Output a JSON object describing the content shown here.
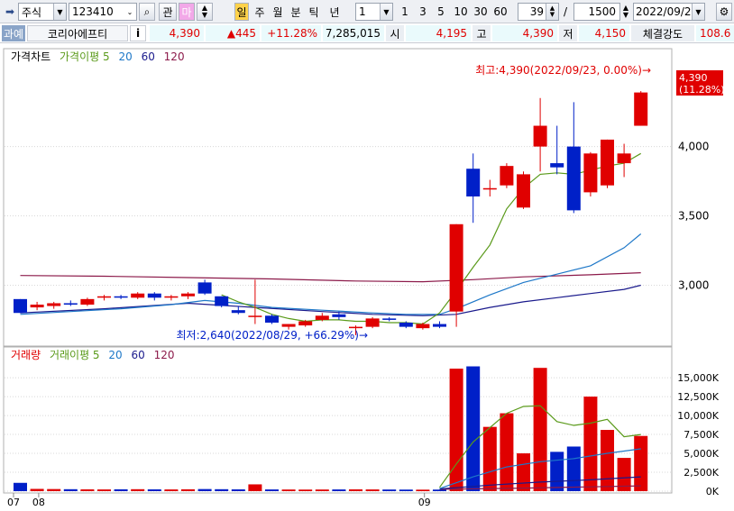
{
  "toolbar": {
    "type_select": "주식",
    "code_value": "123410",
    "btn_gwan": "관",
    "btn_ma": "마",
    "periods": [
      "일",
      "주",
      "월",
      "분",
      "틱",
      "년"
    ],
    "interval_value": "1",
    "quick_intervals": [
      "1",
      "3",
      "5",
      "10",
      "30",
      "60"
    ],
    "count_value": "39",
    "count_sep": "/",
    "count_total": "1500",
    "date_value": "2022/09/23"
  },
  "infobar": {
    "tag": "과예",
    "name": "코리아에프티",
    "info_btn": "i",
    "price": "4,390",
    "change": "▲445",
    "change_pct": "+11.28%",
    "volume": "7,285,015",
    "open_label": "시",
    "open_value": "4,195",
    "high_label": "고",
    "high_value": "4,390",
    "low_label": "저",
    "low_value": "4,150",
    "strength_label": "체결강도",
    "strength_value": "108.6"
  },
  "colors": {
    "up": "#e00000",
    "down": "#0020c8",
    "ma5": "#5a9a1a",
    "ma20": "#1e78c8",
    "ma60": "#1a1a8c",
    "ma120": "#8c1a4a"
  },
  "price_panel": {
    "legend": [
      {
        "label": "가격차트",
        "color": "#000000"
      },
      {
        "label": "가격이평 5",
        "color": "#5a9a1a"
      },
      {
        "label": "20",
        "color": "#1e78c8"
      },
      {
        "label": "60",
        "color": "#1a1a8c"
      },
      {
        "label": "120",
        "color": "#8c1a4a"
      }
    ],
    "high_note": "최고:4,390(2022/09/23, 0.00%)→",
    "low_note": "최저:2,640(2022/08/29, +66.29%)→",
    "last_price": "4,390",
    "last_pct": "(11.28%)"
  },
  "volume_panel": {
    "legend": [
      {
        "label": "거래량",
        "color": "#e00000"
      },
      {
        "label": "거래이평 5",
        "color": "#5a9a1a"
      },
      {
        "label": "20",
        "color": "#1e78c8"
      },
      {
        "label": "60",
        "color": "#1a1a8c"
      },
      {
        "label": "120",
        "color": "#8c1a4a"
      }
    ]
  },
  "x_labels": [
    {
      "label": "07",
      "at": 0
    },
    {
      "label": "08",
      "at": 1.5
    },
    {
      "label": "09",
      "at": 24.5
    }
  ],
  "chart_data": [
    {
      "type": "candlestick",
      "y_ticks": [
        3000,
        3500,
        4000
      ],
      "ylim": [
        2600,
        4550
      ],
      "candles": [
        {
          "o": 2900,
          "h": 2900,
          "l": 2800,
          "c": 2800
        },
        {
          "o": 2840,
          "h": 2880,
          "l": 2820,
          "c": 2860
        },
        {
          "o": 2850,
          "h": 2880,
          "l": 2830,
          "c": 2870
        },
        {
          "o": 2870,
          "h": 2890,
          "l": 2850,
          "c": 2860
        },
        {
          "o": 2860,
          "h": 2910,
          "l": 2850,
          "c": 2900
        },
        {
          "o": 2910,
          "h": 2930,
          "l": 2890,
          "c": 2920
        },
        {
          "o": 2920,
          "h": 2930,
          "l": 2900,
          "c": 2910
        },
        {
          "o": 2910,
          "h": 2950,
          "l": 2900,
          "c": 2940
        },
        {
          "o": 2940,
          "h": 2950,
          "l": 2890,
          "c": 2910
        },
        {
          "o": 2910,
          "h": 2930,
          "l": 2890,
          "c": 2920
        },
        {
          "o": 2920,
          "h": 2950,
          "l": 2900,
          "c": 2940
        },
        {
          "o": 3020,
          "h": 3040,
          "l": 2930,
          "c": 2940
        },
        {
          "o": 2920,
          "h": 2920,
          "l": 2840,
          "c": 2850
        },
        {
          "o": 2820,
          "h": 2850,
          "l": 2790,
          "c": 2800
        },
        {
          "o": 2780,
          "h": 3040,
          "l": 2720,
          "c": 2780
        },
        {
          "o": 2780,
          "h": 2790,
          "l": 2720,
          "c": 2730
        },
        {
          "o": 2700,
          "h": 2720,
          "l": 2680,
          "c": 2720
        },
        {
          "o": 2710,
          "h": 2750,
          "l": 2700,
          "c": 2740
        },
        {
          "o": 2750,
          "h": 2800,
          "l": 2740,
          "c": 2780
        },
        {
          "o": 2790,
          "h": 2810,
          "l": 2750,
          "c": 2770
        },
        {
          "o": 2690,
          "h": 2710,
          "l": 2640,
          "c": 2700
        },
        {
          "o": 2700,
          "h": 2770,
          "l": 2690,
          "c": 2760
        },
        {
          "o": 2760,
          "h": 2770,
          "l": 2740,
          "c": 2750
        },
        {
          "o": 2730,
          "h": 2740,
          "l": 2690,
          "c": 2700
        },
        {
          "o": 2690,
          "h": 2730,
          "l": 2680,
          "c": 2720
        },
        {
          "o": 2720,
          "h": 2740,
          "l": 2690,
          "c": 2700
        },
        {
          "o": 2810,
          "h": 3440,
          "l": 2700,
          "c": 3440
        },
        {
          "o": 3840,
          "h": 3950,
          "l": 3450,
          "c": 3640
        },
        {
          "o": 3690,
          "h": 3760,
          "l": 3640,
          "c": 3700
        },
        {
          "o": 3720,
          "h": 3880,
          "l": 3700,
          "c": 3860
        },
        {
          "o": 3560,
          "h": 3820,
          "l": 3550,
          "c": 3800
        },
        {
          "o": 4000,
          "h": 4350,
          "l": 3820,
          "c": 4150
        },
        {
          "o": 3880,
          "h": 4150,
          "l": 3800,
          "c": 3850
        },
        {
          "o": 4000,
          "h": 4320,
          "l": 3520,
          "c": 3540
        },
        {
          "o": 3670,
          "h": 3960,
          "l": 3640,
          "c": 3950
        },
        {
          "o": 3720,
          "h": 4050,
          "l": 3700,
          "c": 4050
        },
        {
          "o": 3880,
          "h": 4020,
          "l": 3780,
          "c": 3950
        },
        {
          "o": 4150,
          "h": 4400,
          "l": 4150,
          "c": 4390
        }
      ],
      "ma": {
        "ma5": [
          [
            12,
            2930
          ],
          [
            13,
            2880
          ],
          [
            14,
            2840
          ],
          [
            15,
            2790
          ],
          [
            16,
            2760
          ],
          [
            17,
            2740
          ],
          [
            18,
            2750
          ],
          [
            19,
            2750
          ],
          [
            20,
            2740
          ],
          [
            21,
            2740
          ],
          [
            22,
            2730
          ],
          [
            23,
            2730
          ],
          [
            24,
            2720
          ],
          [
            25,
            2800
          ],
          [
            26,
            2960
          ],
          [
            27,
            3130
          ],
          [
            28,
            3290
          ],
          [
            29,
            3550
          ],
          [
            30,
            3700
          ],
          [
            31,
            3800
          ],
          [
            32,
            3810
          ],
          [
            33,
            3800
          ],
          [
            34,
            3830
          ],
          [
            35,
            3860
          ],
          [
            36,
            3880
          ],
          [
            37,
            3950
          ]
        ],
        "ma20": [
          [
            0,
            2790
          ],
          [
            3,
            2810
          ],
          [
            6,
            2830
          ],
          [
            9,
            2860
          ],
          [
            11,
            2890
          ],
          [
            13,
            2870
          ],
          [
            15,
            2840
          ],
          [
            18,
            2820
          ],
          [
            21,
            2800
          ],
          [
            23,
            2790
          ],
          [
            25,
            2790
          ],
          [
            26,
            2830
          ],
          [
            28,
            2930
          ],
          [
            30,
            3020
          ],
          [
            32,
            3080
          ],
          [
            34,
            3140
          ],
          [
            36,
            3270
          ],
          [
            37,
            3370
          ]
        ],
        "ma60": [
          [
            0,
            2800
          ],
          [
            5,
            2830
          ],
          [
            10,
            2870
          ],
          [
            14,
            2840
          ],
          [
            18,
            2810
          ],
          [
            21,
            2790
          ],
          [
            24,
            2780
          ],
          [
            26,
            2790
          ],
          [
            28,
            2840
          ],
          [
            30,
            2880
          ],
          [
            32,
            2910
          ],
          [
            34,
            2940
          ],
          [
            36,
            2970
          ],
          [
            37,
            3000
          ]
        ],
        "ma120": [
          [
            0,
            3070
          ],
          [
            5,
            3065
          ],
          [
            10,
            3055
          ],
          [
            15,
            3045
          ],
          [
            20,
            3030
          ],
          [
            24,
            3025
          ],
          [
            27,
            3040
          ],
          [
            30,
            3060
          ],
          [
            34,
            3075
          ],
          [
            37,
            3090
          ]
        ]
      }
    },
    {
      "type": "bar",
      "y_ticks": [
        0,
        2500,
        5000,
        7500,
        10000,
        12500,
        15000
      ],
      "y_tick_labels": [
        "0K",
        "2,500K",
        "5,000K",
        "7,500K",
        "10,000K",
        "12,500K",
        "15,000K"
      ],
      "ylim": [
        0,
        16800
      ],
      "values": [
        1100,
        300,
        280,
        260,
        240,
        230,
        250,
        260,
        240,
        230,
        250,
        280,
        260,
        240,
        900,
        230,
        220,
        210,
        220,
        230,
        240,
        230,
        220,
        210,
        200,
        210,
        16200,
        16500,
        8500,
        10300,
        5000,
        16300,
        5200,
        5900,
        12500,
        8100,
        4400,
        7300
      ],
      "ma": {
        "ma5": [
          [
            25,
            500
          ],
          [
            26,
            3600
          ],
          [
            27,
            6500
          ],
          [
            28,
            8400
          ],
          [
            29,
            10300
          ],
          [
            30,
            11200
          ],
          [
            31,
            11300
          ],
          [
            32,
            9200
          ],
          [
            33,
            8700
          ],
          [
            34,
            9000
          ],
          [
            35,
            9500
          ],
          [
            36,
            7200
          ],
          [
            37,
            7500
          ]
        ],
        "ma20": [
          [
            25,
            350
          ],
          [
            27,
            1900
          ],
          [
            29,
            3200
          ],
          [
            31,
            3900
          ],
          [
            33,
            4300
          ],
          [
            35,
            5000
          ],
          [
            37,
            5600
          ]
        ],
        "ma60": [
          [
            25,
            300
          ],
          [
            28,
            800
          ],
          [
            31,
            1200
          ],
          [
            34,
            1500
          ],
          [
            37,
            1900
          ]
        ],
        "ma120": [
          [
            25,
            250
          ],
          [
            30,
            400
          ],
          [
            37,
            700
          ]
        ]
      }
    }
  ]
}
